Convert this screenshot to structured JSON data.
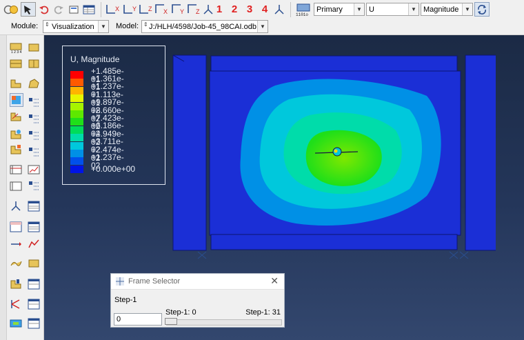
{
  "toolbar": {
    "view_buttons": [
      "X",
      "Y",
      "Z",
      "X",
      "Y",
      "Z"
    ],
    "frame_numbers": [
      "1",
      "2",
      "3",
      "4"
    ],
    "primary_select": "Primary",
    "variable_select": "U",
    "invariant_select": "Magnitude"
  },
  "context": {
    "module_label": "Module:",
    "module_value": "Visualization",
    "model_label": "Model:",
    "model_value": "J:/HLH/4598/Job-45_98CAI.odb"
  },
  "legend": {
    "title": "U, Magnitude",
    "entries": [
      {
        "value": "+1.485e-01",
        "color": "#ff0000"
      },
      {
        "value": "+1.361e-01",
        "color": "#ff5a00"
      },
      {
        "value": "+1.237e-01",
        "color": "#ffb400"
      },
      {
        "value": "+1.113e-01",
        "color": "#e8f500"
      },
      {
        "value": "+9.897e-02",
        "color": "#a6f400"
      },
      {
        "value": "+8.660e-02",
        "color": "#5ee800"
      },
      {
        "value": "+7.423e-02",
        "color": "#1fdf19"
      },
      {
        "value": "+6.186e-02",
        "color": "#00dc5a"
      },
      {
        "value": "+4.949e-02",
        "color": "#00dcaa"
      },
      {
        "value": "+3.711e-02",
        "color": "#00c8dc"
      },
      {
        "value": "+2.474e-02",
        "color": "#0090e6"
      },
      {
        "value": "+1.237e-02",
        "color": "#0050eb"
      },
      {
        "value": "+0.000e+00",
        "color": "#0014e6"
      }
    ]
  },
  "frame_selector": {
    "title": "Frame Selector",
    "step_name": "Step-1",
    "frame_value": "0",
    "slider_min_label": "Step-1: 0",
    "slider_max_label": "Step-1: 31",
    "current_fraction": 0
  },
  "colors": {
    "viewport_bg_top": "#1b2a45",
    "model_blue": "#1b2fd6",
    "accent_red": "#e02020"
  }
}
